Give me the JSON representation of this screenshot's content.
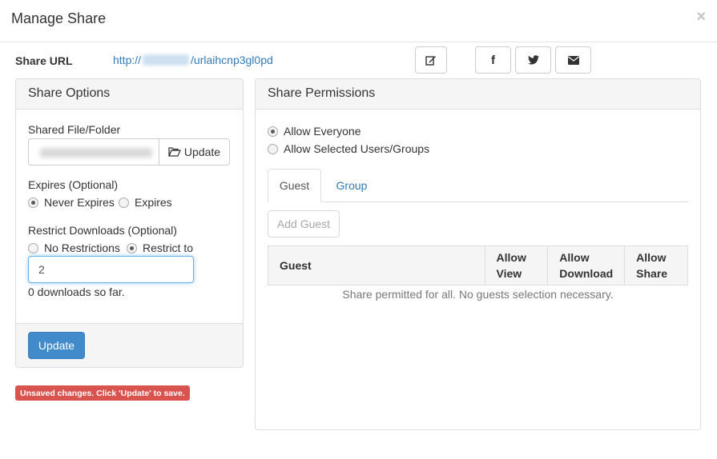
{
  "modal": {
    "title": "Manage Share",
    "close": "×"
  },
  "share_url": {
    "label": "Share URL",
    "prefix": "http://",
    "suffix": "/urlaihcnp3gl0pd"
  },
  "actions": {
    "edit_icon": "edit-icon",
    "facebook_glyph": "f",
    "twitter_icon": "twitter-icon",
    "email_icon": "envelope-icon"
  },
  "share_options": {
    "title": "Share Options",
    "file_label": "Shared File/Folder",
    "update_button": "Update",
    "expires_label": "Expires (Optional)",
    "never_expires": "Never Expires",
    "expires": "Expires",
    "restrict_label": "Restrict Downloads (Optional)",
    "no_restrictions": "No Restrictions",
    "restrict_to": "Restrict to",
    "restrict_value": "2",
    "downloads_so_far": "0 downloads so far.",
    "footer_button": "Update"
  },
  "unsaved": "Unsaved changes. Click 'Update' to save.",
  "share_permissions": {
    "title": "Share Permissions",
    "allow_everyone": "Allow Everyone",
    "allow_selected": "Allow Selected Users/Groups",
    "tabs": [
      "Guest",
      "Group"
    ],
    "add_guest": "Add Guest",
    "table": {
      "headers": [
        "Guest",
        "Allow View",
        "Allow Download",
        "Allow Share"
      ],
      "empty": "Share permitted for all. No guests selection necessary."
    }
  }
}
